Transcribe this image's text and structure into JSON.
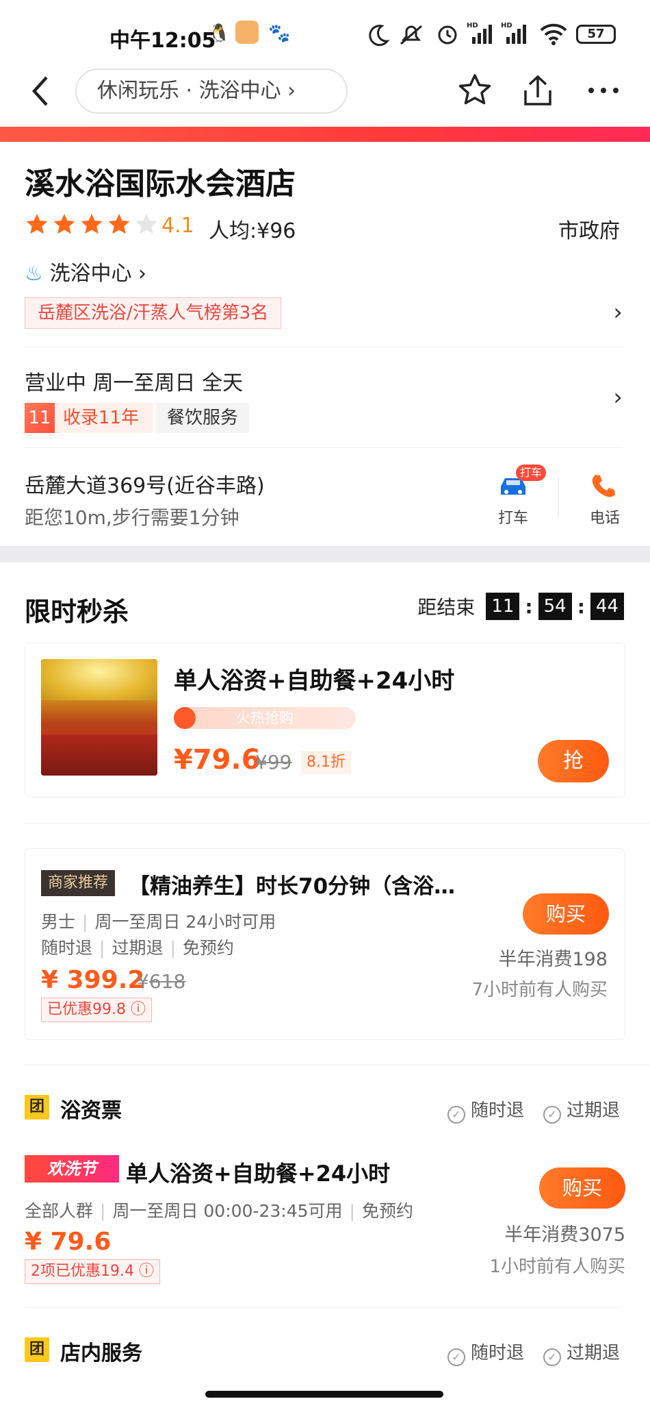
{
  "status_bar": {
    "time": "中午12:05",
    "battery": "57",
    "hd1": "HD",
    "hd2": "HD"
  },
  "nav": {
    "breadcrumb": "休闲玩乐 · 洗浴中心 ›"
  },
  "shop": {
    "name": "溪水浴国际水会酒店",
    "rating": "4.1",
    "rating_value": 4.1,
    "avg_price": "人均:¥96",
    "district": "市政府",
    "category": "洗浴中心 ›",
    "rank_badge": "岳麓区洗浴/汗蒸人气榜第3名",
    "hours": "营业中  周一至周日 全天",
    "years_num": "11",
    "years_label": "收录11年",
    "service_tag": "餐饮服务",
    "address": "岳麓大道369号(近谷丰路)",
    "distance": "距您10m,步行需要1分钟",
    "taxi_badge": "打车",
    "taxi_label": "打车",
    "phone_label": "电话"
  },
  "flash_sale": {
    "title": "限时秒杀",
    "countdown_label": "距结束",
    "hh": "11",
    "mm": "54",
    "ss": "44",
    "item_name": "单人浴资+自助餐+24小时",
    "hot_label": "火热抢购",
    "price": "¥79.6",
    "original": "¥99",
    "discount": "8.1折",
    "button": "抢"
  },
  "recommended": {
    "tag": "商家推荐",
    "name": "【精油养生】时长70分钟（含浴…",
    "meta1": [
      "男士",
      "周一至周日 24小时可用"
    ],
    "meta2": [
      "随时退",
      "过期退",
      "免预约"
    ],
    "price": "¥ 399.2",
    "original_prefix": "¥",
    "original": "618",
    "saved": "已优惠99.8 ⓘ",
    "button": "购买",
    "sales": "半年消费198",
    "recent": "7小时前有人购买"
  },
  "bath_section": {
    "icon": "团",
    "title": "浴资票",
    "refund1": "随时退",
    "refund2": "过期退",
    "festival_tag": "欢洗节",
    "item_name": "单人浴资+自助餐+24小时",
    "meta": [
      "全部人群",
      "周一至周日 00:00-23:45可用",
      "免预约"
    ],
    "price": "¥ 79.6",
    "saved": "2项已优惠19.4 ⓘ",
    "button": "购买",
    "sales": "半年消费3075",
    "recent": "1小时前有人购买"
  },
  "service_section": {
    "icon": "团",
    "title": "店内服务",
    "refund1": "随时退",
    "refund2": "过期退"
  },
  "colors": {
    "accent": "#ff5a1a",
    "star": "#ff6a1a",
    "brand_red": "#ff3a3a"
  }
}
